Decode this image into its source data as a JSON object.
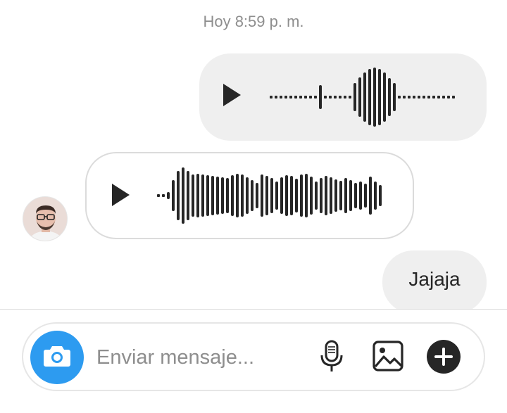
{
  "chat": {
    "timestamp": "Hoy 8:59 p. m.",
    "messages": [
      {
        "type": "voice",
        "direction": "outgoing"
      },
      {
        "type": "voice",
        "direction": "incoming"
      },
      {
        "type": "text",
        "direction": "outgoing",
        "text": "Jajaja"
      }
    ]
  },
  "composer": {
    "placeholder": "Enviar mensaje...",
    "icons": [
      "camera-icon",
      "microphone-icon",
      "gallery-icon",
      "plus-icon"
    ]
  },
  "colors": {
    "accent": "#2d9bf0",
    "bubble_outgoing": "#efefef",
    "text_primary": "#262626",
    "text_secondary": "#8e8e8e"
  }
}
